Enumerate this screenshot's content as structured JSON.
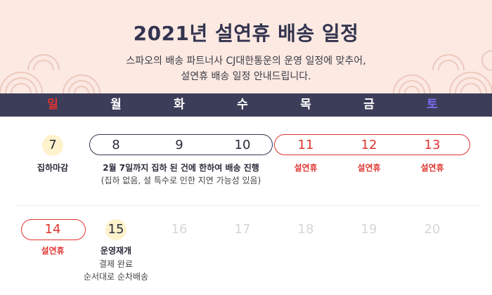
{
  "title": "2021년 설연휴 배송 일정",
  "subtitle_line1": "스파오의 배송 파트너사 CJ대한통운의 운영 일정에 맞추어,",
  "subtitle_line2": "설연휴 배송 일정 안내드립니다.",
  "weekdays": [
    "일",
    "월",
    "화",
    "수",
    "목",
    "금",
    "토"
  ],
  "colors": {
    "header_bg": "#fbe9e2",
    "navy": "#3c3d59",
    "red": "#e0342f",
    "sunday": "#e0342f",
    "saturday": "#7d6cf0",
    "highlight": "#fdf2cc",
    "inactive": "#d6d6d6"
  },
  "week1": {
    "dates": [
      "7",
      "8",
      "9",
      "10",
      "11",
      "12",
      "13"
    ],
    "day7_label": "집하마감",
    "pickup_notice": "2월 7일까지 집하 된 건에 한하여 배송 진행",
    "pickup_notice_sub": "(집하 없음, 설 특수로 인한 지연 가능성 있음)",
    "holiday_label": "설연휴"
  },
  "week2": {
    "dates": [
      "14",
      "15",
      "16",
      "17",
      "18",
      "19",
      "20"
    ],
    "holiday_label": "설연휴",
    "day15_label": "운영재개",
    "day15_note1": "결제 완료",
    "day15_note2": "순서대로 순차배송"
  }
}
